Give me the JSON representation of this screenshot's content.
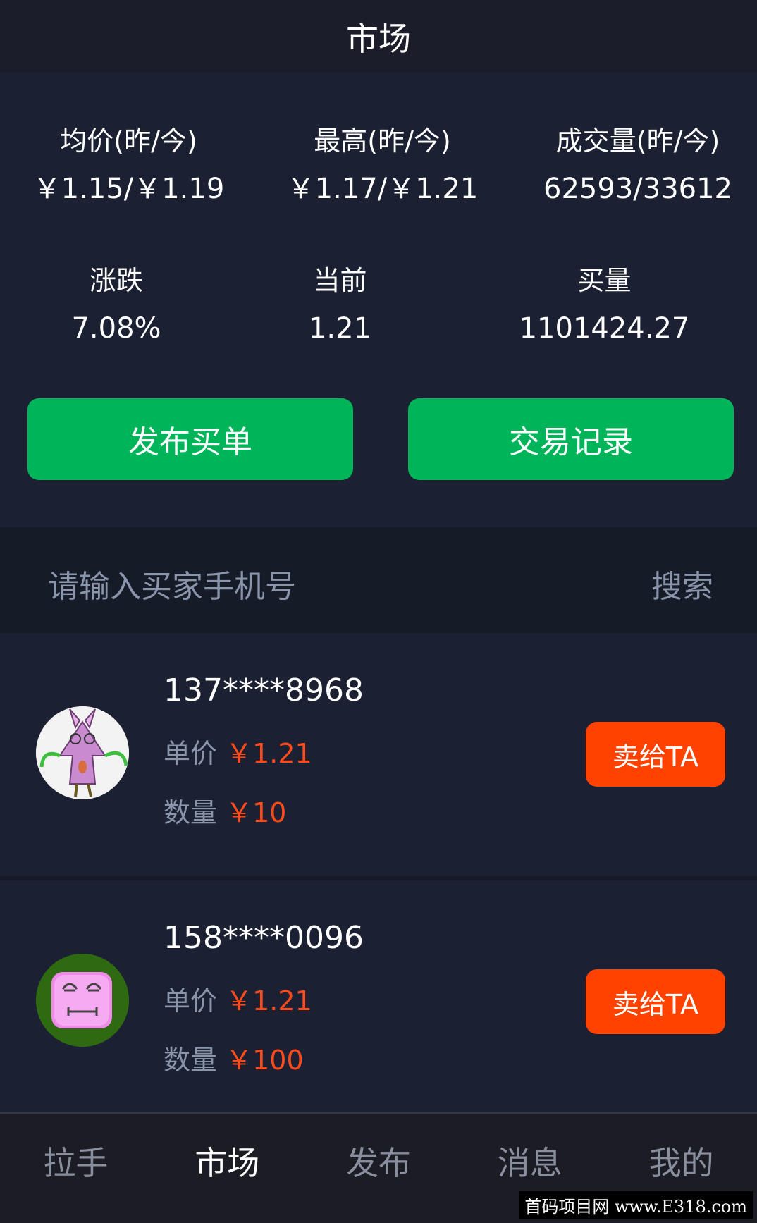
{
  "header": {
    "title": "市场"
  },
  "stats": {
    "avg_label": "均价(昨/今)",
    "avg_value": "￥1.15/￥1.19",
    "high_label": "最高(昨/今)",
    "high_value": "￥1.17/￥1.21",
    "volume_label": "成交量(昨/今)",
    "volume_value": "62593/33612",
    "change_label": "涨跌",
    "change_value": "7.08%",
    "current_label": "当前",
    "current_value": "1.21",
    "buy_label": "买量",
    "buy_value": "1101424.27"
  },
  "actions": {
    "post_buy": "发布买单",
    "trade_records": "交易记录"
  },
  "search": {
    "placeholder": "请输入买家手机号",
    "button": "搜索"
  },
  "orders": [
    {
      "phone": "137****8968",
      "price_label": "单价",
      "price": "￥1.21",
      "qty_label": "数量",
      "qty": "￥10",
      "action": "卖给TA"
    },
    {
      "phone": "158****0096",
      "price_label": "单价",
      "price": "￥1.21",
      "qty_label": "数量",
      "qty": "￥100",
      "action": "卖给TA"
    }
  ],
  "tabs": [
    "拉手",
    "市场",
    "发布",
    "消息",
    "我的"
  ],
  "active_tab": "市场",
  "watermark": "首码项目网 www.E318.com",
  "colors": {
    "accent_green": "#00b559",
    "accent_orange": "#ff4200",
    "price_red": "#ff4a1c"
  }
}
